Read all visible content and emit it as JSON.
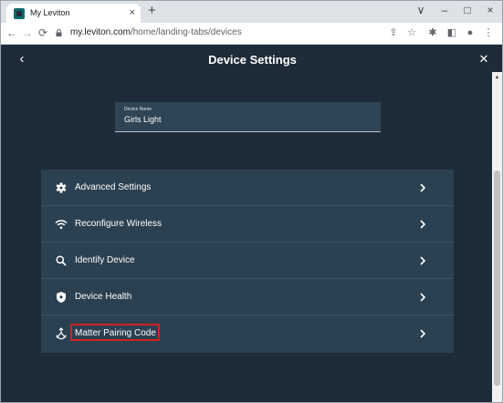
{
  "browser": {
    "tab_title": "My Leviton",
    "tab_close": "×",
    "new_tab": "+",
    "window_controls": [
      "∨",
      "–",
      "□",
      "×"
    ],
    "url_host": "my.leviton.com",
    "url_path": "/home/landing-tabs/devices"
  },
  "header": {
    "title": "Device Settings",
    "back_glyph": "‹",
    "close_glyph": "✕"
  },
  "device_name": {
    "label": "Device Name",
    "value": "Girls Light"
  },
  "settings": {
    "items": [
      {
        "label": "Advanced Settings",
        "icon": "gear-icon"
      },
      {
        "label": "Reconfigure Wireless",
        "icon": "wifi-icon"
      },
      {
        "label": "Identify Device",
        "icon": "search-icon"
      },
      {
        "label": "Device Health",
        "icon": "shield-icon"
      },
      {
        "label": "Matter Pairing Code",
        "icon": "matter-icon",
        "highlighted": true
      }
    ]
  },
  "colors": {
    "app_background": "#1e2b38",
    "list_background": "#2b4050",
    "highlight": "#d32020"
  }
}
